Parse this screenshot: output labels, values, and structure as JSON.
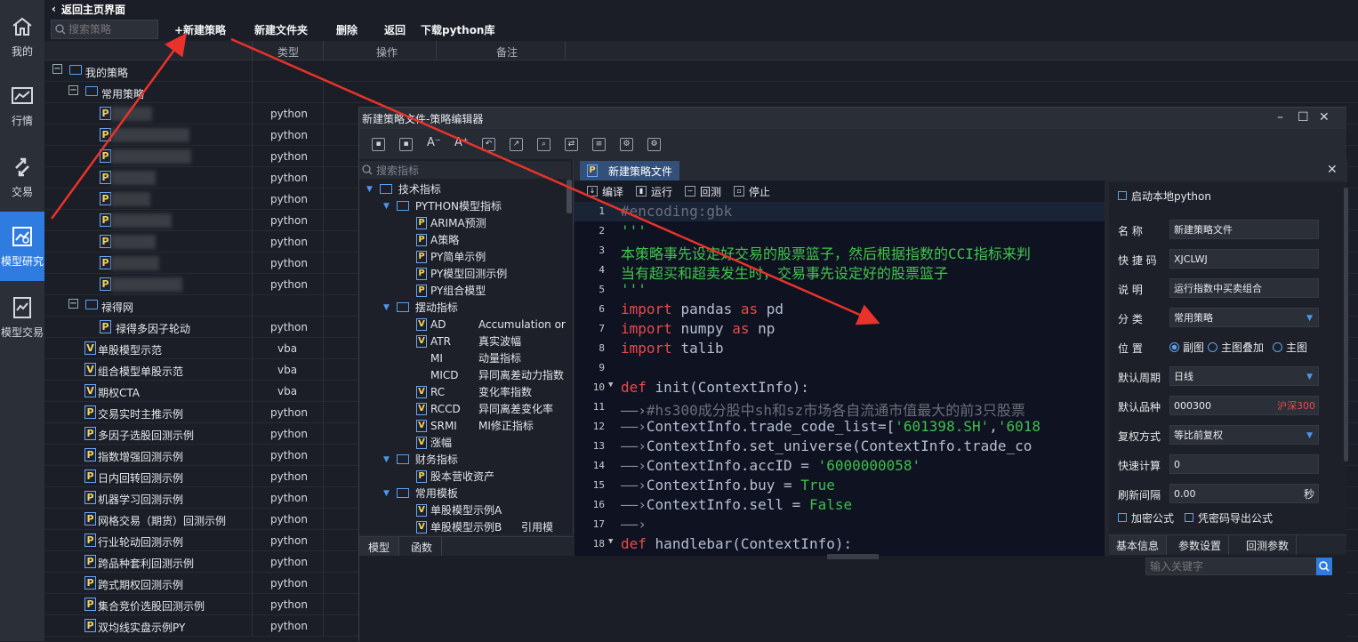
{
  "nav": [
    {
      "label": "我的",
      "icon": "home-icon"
    },
    {
      "label": "行情",
      "icon": "chart-icon"
    },
    {
      "label": "交易",
      "icon": "exchange-icon"
    },
    {
      "label": "模型研究",
      "icon": "research-icon"
    },
    {
      "label": "模型交易",
      "icon": "model-trade-icon"
    }
  ],
  "back_label": "返回主页界面",
  "toolbar": {
    "search_placeholder": "搜索策略",
    "new_strategy": "+新建策略",
    "new_folder": "新建文件夹",
    "delete": "删除",
    "back": "返回",
    "download": "下载python库"
  },
  "columns": {
    "type": "类型",
    "action": "操作",
    "note": "备注"
  },
  "tree": {
    "root": "我的策略",
    "group1": "常用策略",
    "group1_types": [
      "python",
      "python",
      "python",
      "python",
      "python",
      "python",
      "python",
      "python",
      "python"
    ],
    "group2": "禄得网",
    "group2_item": "禄得多因子轮动",
    "group2_item_type": "python",
    "items": [
      {
        "name": "单股模型示范",
        "type": "vba"
      },
      {
        "name": "组合模型单股示范",
        "type": "vba"
      },
      {
        "name": "期权CTA",
        "type": "vba"
      },
      {
        "name": "交易实时主推示例",
        "type": "python"
      },
      {
        "name": "多因子选股回测示例",
        "type": "python"
      },
      {
        "name": "指数增强回测示例",
        "type": "python"
      },
      {
        "name": "日内回转回测示例",
        "type": "python"
      },
      {
        "name": "机器学习回测示例",
        "type": "python"
      },
      {
        "name": "网格交易（期货）回测示例",
        "type": "python"
      },
      {
        "name": "行业轮动回测示例",
        "type": "python"
      },
      {
        "name": "跨品种套利回测示例",
        "type": "python"
      },
      {
        "name": "跨式期权回测示例",
        "type": "python"
      },
      {
        "name": "集合竞价选股回测示例",
        "type": "python"
      },
      {
        "name": "双均线实盘示例PY",
        "type": "python"
      }
    ]
  },
  "editor": {
    "title": "新建策略文件-策略编辑器",
    "indicator_search": "搜索指标",
    "indicators": [
      {
        "level": 0,
        "kind": "folder",
        "name": "技术指标"
      },
      {
        "level": 1,
        "kind": "folder",
        "name": "PYTHON模型指标"
      },
      {
        "level": 2,
        "kind": "p",
        "name": "ARIMA预测",
        "desc": ""
      },
      {
        "level": 2,
        "kind": "p",
        "name": "A策略",
        "desc": ""
      },
      {
        "level": 2,
        "kind": "p",
        "name": "PY简单示例",
        "desc": ""
      },
      {
        "level": 2,
        "kind": "p",
        "name": "PY模型回测示例",
        "desc": ""
      },
      {
        "level": 2,
        "kind": "p",
        "name": "PY组合模型",
        "desc": ""
      },
      {
        "level": 1,
        "kind": "folder",
        "name": "摆动指标"
      },
      {
        "level": 2,
        "kind": "v",
        "name": "AD",
        "desc": "Accumulation or"
      },
      {
        "level": 2,
        "kind": "v",
        "name": "ATR",
        "desc": "真实波幅"
      },
      {
        "level": 2,
        "kind": "none",
        "name": "MI",
        "desc": "动量指标"
      },
      {
        "level": 2,
        "kind": "none",
        "name": "MICD",
        "desc": "异同离差动力指数"
      },
      {
        "level": 2,
        "kind": "v",
        "name": "RC",
        "desc": "变化率指数"
      },
      {
        "level": 2,
        "kind": "v",
        "name": "RCCD",
        "desc": "异同离差变化率"
      },
      {
        "level": 2,
        "kind": "v",
        "name": "SRMI",
        "desc": "MI修正指标"
      },
      {
        "level": 2,
        "kind": "v",
        "name": "涨幅",
        "desc": ""
      },
      {
        "level": 1,
        "kind": "folder",
        "name": "财务指标"
      },
      {
        "level": 2,
        "kind": "p",
        "name": "股本营收资产",
        "desc": ""
      },
      {
        "level": 1,
        "kind": "folder",
        "name": "常用模板"
      },
      {
        "level": 2,
        "kind": "v",
        "name": "单股模型示例A",
        "desc": ""
      },
      {
        "level": 2,
        "kind": "v",
        "name": "单股模型示例B",
        "desc": "引用模"
      }
    ],
    "left_tabs": [
      "模型",
      "函数"
    ],
    "file_tab": "新建策略文件",
    "code_tools": [
      "编译",
      "运行",
      "回测",
      "停止"
    ],
    "code_lines": [
      {
        "n": "1",
        "html": "<span class='cm'>#encoding:gbk</span>"
      },
      {
        "n": "2",
        "html": "<span class='gr'>'''</span>"
      },
      {
        "n": "3",
        "html": "<span class='gr'>本策略事先设定好交易的股票篮子，然后根据指数的CCI指标来判</span>"
      },
      {
        "n": "4",
        "html": "<span class='gr'>当有超买和超卖发生时，交易事先设定好的股票篮子</span>"
      },
      {
        "n": "5",
        "html": "<span class='gr'>'''</span>"
      },
      {
        "n": "6",
        "html": "<span class='kw'>import</span> <span class='id'>pandas</span> <span class='kw'>as</span> <span class='id'>pd</span>"
      },
      {
        "n": "7",
        "html": "<span class='kw'>import</span> <span class='id'>numpy</span> <span class='kw'>as</span> <span class='id'>np</span>"
      },
      {
        "n": "8",
        "html": "<span class='kw'>import</span> <span class='id'>talib</span>"
      },
      {
        "n": "9",
        "html": ""
      },
      {
        "n": "10",
        "html": "<span class='kw'>def</span> <span class='id'>init(ContextInfo):</span>"
      },
      {
        "n": "11",
        "html": "<span class='ar'>——›</span><span class='cm'>#hs300成分股中sh和sz市场各自流通市值最大的前3只股票</span>"
      },
      {
        "n": "12",
        "html": "<span class='ar'>——›</span><span class='id'>ContextInfo.trade_code_list=[</span><span class='str'>'601398.SH'</span><span class='id'>,</span><span class='str'>'6018</span>"
      },
      {
        "n": "13",
        "html": "<span class='ar'>——›</span><span class='id'>ContextInfo.set_universe(ContextInfo.trade_co</span>"
      },
      {
        "n": "14",
        "html": "<span class='ar'>——›</span><span class='id'>ContextInfo.accID = </span><span class='str'>'6000000058'</span>"
      },
      {
        "n": "15",
        "html": "<span class='ar'>——›</span><span class='id'>ContextInfo.buy = </span><span class='str'>True</span>"
      },
      {
        "n": "16",
        "html": "<span class='ar'>——›</span><span class='id'>ContextInfo.sell = </span><span class='str'>False</span>"
      },
      {
        "n": "17",
        "html": "<span class='ar'>——›</span>"
      },
      {
        "n": "18",
        "html": "<span class='kw'>def</span> <span class='id'>handlebar(ContextInfo):</span>"
      }
    ],
    "props": {
      "local_python": "启动本地python",
      "name_label": "名  称",
      "name_value": "新建策略文件",
      "shortcut_label": "快 捷 码",
      "shortcut_value": "XJCLWJ",
      "desc_label": "说  明",
      "desc_value": "运行指数中买卖组合",
      "category_label": "分  类",
      "category_value": "常用策略",
      "position_label": "位  置",
      "position_options": [
        "副图",
        "主图叠加",
        "主图"
      ],
      "period_label": "默认周期",
      "period_value": "日线",
      "symbol_label": "默认品种",
      "symbol_value": "000300",
      "symbol_name": "沪深300",
      "adjust_label": "复权方式",
      "adjust_value": "等比前复权",
      "fastcalc_label": "快速计算",
      "fastcalc_value": "0",
      "refresh_label": "刷新间隔",
      "refresh_value": "0.00",
      "refresh_unit": "秒",
      "encrypt_label": "加密公式",
      "export_label": "凭密码导出公式"
    },
    "right_tabs": [
      "基本信息",
      "参数设置",
      "回测参数"
    ],
    "keyword_placeholder": "输入关键字"
  },
  "colors": {
    "accent": "#2f7ce0",
    "arrow": "#e8322b"
  }
}
